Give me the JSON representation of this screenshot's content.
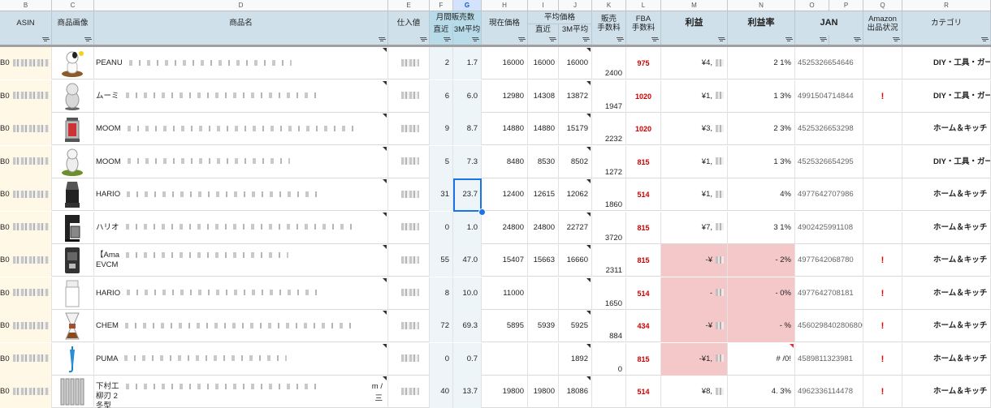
{
  "column_letters": [
    "B",
    "C",
    "D",
    "E",
    "F",
    "G",
    "H",
    "I",
    "J",
    "K",
    "L",
    "M",
    "N",
    "O",
    "P",
    "Q",
    "R"
  ],
  "headers": {
    "asin": "ASIN",
    "image": "商品画像",
    "name": "商品名",
    "cost": "仕入値",
    "monthly_sales": "月間販売数",
    "monthly_recent": "直近",
    "monthly_3m": "3M平均",
    "current_price": "現在価格",
    "avg_price": "平均価格",
    "avg_recent": "直近",
    "avg_3m": "3M平均",
    "sales_fee": "販売\n手数料",
    "fba_fee": "FBA\n手数料",
    "profit": "利益",
    "profit_rate": "利益率",
    "jan": "JAN",
    "amazon_status": "Amazon\n出品状況",
    "category": "カテゴリ"
  },
  "rows": [
    {
      "asin": "B0",
      "name": "PEANU",
      "recent": "2",
      "avg3m": "1.7",
      "price": "16000",
      "avg_recent": "16000",
      "avg_3m": "16000",
      "sales_fee": "2400",
      "fba": "975",
      "profit": "¥4,",
      "rate": "2 1%",
      "jan": "4525326654646",
      "status": "",
      "category": "DIY・工具・ガー",
      "thumb": "peanuts"
    },
    {
      "asin": "B0",
      "name": "ムーミ",
      "recent": "6",
      "avg3m": "6.0",
      "price": "12980",
      "avg_recent": "14308",
      "avg_3m": "13872",
      "sales_fee": "1947",
      "fba": "1020",
      "profit": "¥1,",
      "rate": "1 3%",
      "jan": "4991504714844",
      "status": "!",
      "category": "DIY・工具・ガー",
      "thumb": "moomin"
    },
    {
      "asin": "B0",
      "name": "MOOM",
      "recent": "9",
      "avg3m": "8.7",
      "price": "14880",
      "avg_recent": "14880",
      "avg_3m": "15179",
      "sales_fee": "2232",
      "fba": "1020",
      "profit": "¥3,",
      "rate": "2 3%",
      "jan": "4525326653298",
      "status": "",
      "category": "ホーム＆キッチ",
      "thumb": "lantern"
    },
    {
      "asin": "B0",
      "name": "MOOM",
      "recent": "5",
      "avg3m": "7.3",
      "price": "8480",
      "avg_recent": "8530",
      "avg_3m": "8502",
      "sales_fee": "1272",
      "fba": "815",
      "profit": "¥1,",
      "rate": "1 3%",
      "jan": "4525326654295",
      "status": "",
      "category": "DIY・工具・ガー",
      "thumb": "moomin2"
    },
    {
      "asin": "B0",
      "name": "HARIO",
      "recent": "31",
      "avg3m": "23.7",
      "price": "12400",
      "avg_recent": "12615",
      "avg_3m": "12062",
      "sales_fee": "1860",
      "fba": "514",
      "profit": "¥1,",
      "rate": "4%",
      "jan": "4977642707986",
      "status": "",
      "category": "ホーム＆キッチ",
      "thumb": "grinder"
    },
    {
      "asin": "B0",
      "name": "ハリオ",
      "recent": "0",
      "avg3m": "1.0",
      "price": "24800",
      "avg_recent": "24800",
      "avg_3m": "22727",
      "sales_fee": "3720",
      "fba": "815",
      "profit": "¥7,",
      "rate": "3 1%",
      "jan": "4902425991108",
      "status": "",
      "category": "ホーム＆キッチ",
      "thumb": "coffeemaker"
    },
    {
      "asin": "B0",
      "name": "【Ama",
      "name2": "EVCM",
      "recent": "55",
      "avg3m": "47.0",
      "price": "15407",
      "avg_recent": "15663",
      "avg_3m": "16660",
      "sales_fee": "2311",
      "fba": "815",
      "profit": "-¥",
      "rate": "- 2%",
      "jan": "4977642068780",
      "status": "!",
      "category": "ホーム＆キッチ",
      "thumb": "espresso",
      "pink": true
    },
    {
      "asin": "B0",
      "name": "HARIO",
      "recent": "8",
      "avg3m": "10.0",
      "price": "11000",
      "avg_recent": "",
      "avg_3m": "",
      "sales_fee": "1650",
      "fba": "514",
      "profit": "-",
      "rate": "- 0%",
      "jan": "4977642708181",
      "status": "!",
      "category": "ホーム＆キッチ",
      "thumb": "whitegrinder",
      "pink": true
    },
    {
      "asin": "B0",
      "name": "CHEM",
      "recent": "72",
      "avg3m": "69.3",
      "price": "5895",
      "avg_recent": "5939",
      "avg_3m": "5925",
      "sales_fee": "884",
      "fba": "434",
      "profit": "-¥",
      "rate": "- %",
      "jan": "4560298402806800",
      "status": "!",
      "category": "ホーム＆キッチ",
      "thumb": "chemex",
      "pink": true
    },
    {
      "asin": "B0",
      "name": "PUMA",
      "recent": "0",
      "avg3m": "0.7",
      "price": "",
      "avg_recent": "",
      "avg_3m": "1892",
      "sales_fee": "0",
      "fba": "815",
      "profit": "-¥1,",
      "rate": "#  /0!",
      "jan": "4589811323981",
      "status": "!",
      "category": "ホーム＆キッチ",
      "thumb": "umbrella",
      "pink_profit": true
    },
    {
      "asin": "B0",
      "name": "下村工",
      "name2": "柳刃 2",
      "name3": "冬型",
      "recent": "40",
      "avg3m": "13.7",
      "price": "19800",
      "avg_recent": "19800",
      "avg_3m": "18086",
      "sales_fee": "",
      "fba": "514",
      "profit": "¥8,",
      "rate": "4. 3%",
      "jan": "4962336114478",
      "status": "!",
      "category": "ホーム＆キッチ",
      "thumb": "knives",
      "name_tail": "m /",
      "name_tail2": "三"
    }
  ]
}
